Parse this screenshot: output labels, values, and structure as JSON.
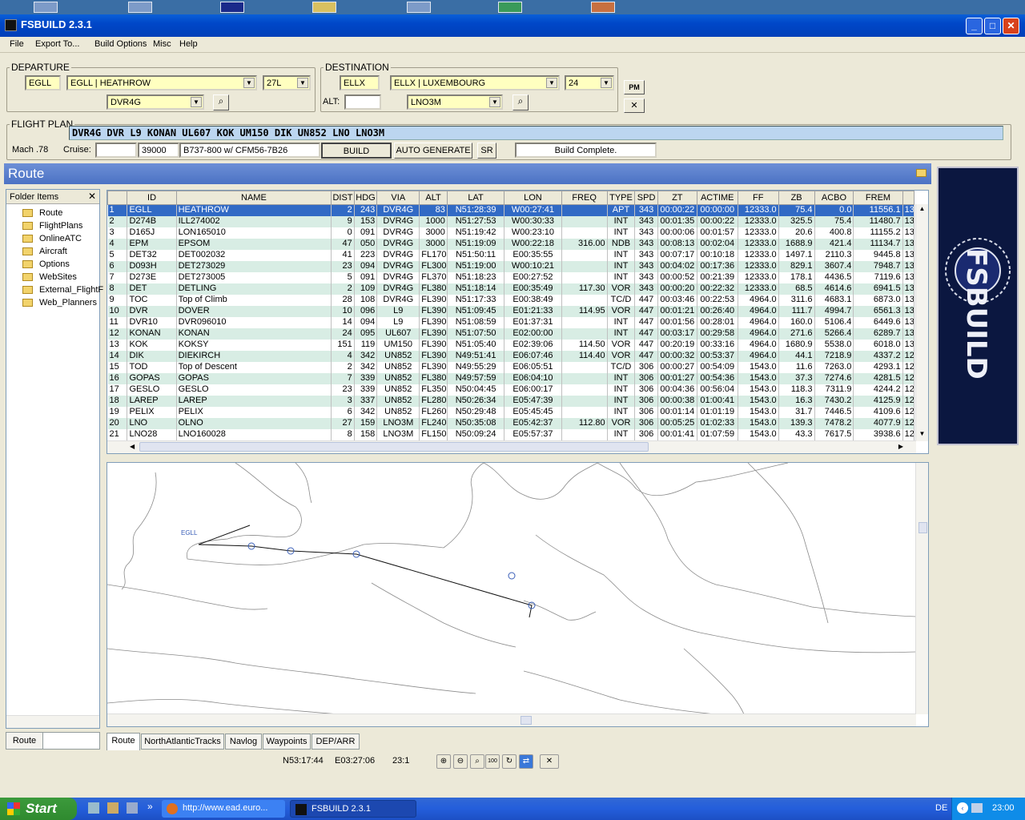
{
  "window": {
    "title": "FSBUILD 2.3.1"
  },
  "menu": [
    "File",
    "Export To...",
    "Build Options",
    "Misc",
    "Help"
  ],
  "departure": {
    "legend": "DEPARTURE",
    "icao": "EGLL",
    "airport": "EGLL | HEATHROW",
    "runway": "27L",
    "sid": "DVR4G"
  },
  "destination": {
    "legend": "DESTINATION",
    "icao": "ELLX",
    "airport": "ELLX | LUXEMBOURG",
    "runway": "24",
    "alt_label": "ALT:",
    "alt_value": "",
    "star": "LNO3M"
  },
  "buttons": {
    "pm": "PM",
    "close": "✕",
    "build": "BUILD",
    "auto": "AUTO GENERATE",
    "sr": "SR"
  },
  "flightplan": {
    "legend": "FLIGHT PLAN",
    "route": "DVR4G DVR L9 KONAN UL607 KOK UM150 DIK UN852 LNO  LNO3M",
    "mach": "Mach .78",
    "cruise_label": "Cruise:",
    "cruise_blank": "",
    "cruise_alt": "39000",
    "aircraft": "B737-800 w/ CFM56-7B26",
    "status": "Build Complete."
  },
  "section_title": "Route",
  "folders": {
    "header": "Folder Items",
    "items": [
      "Route",
      "FlightPlans",
      "OnlineATC",
      "Aircraft",
      "Options",
      "WebSites",
      "External_FlightF",
      "Web_Planners"
    ],
    "bottom_tab": "Route"
  },
  "grid": {
    "columns": [
      "",
      "ID",
      "NAME",
      "DIST",
      "HDG",
      "VIA",
      "ALT",
      "LAT",
      "LON",
      "FREQ",
      "TYPE",
      "SPD",
      "ZT",
      "ACTIME",
      "FF",
      "ZB",
      "ACBO",
      "FREM",
      ""
    ],
    "rows": [
      [
        "1",
        "EGLL",
        "HEATHROW",
        "2",
        "243",
        "DVR4G",
        "83",
        "N51:28:39",
        "W00:27:41",
        "",
        "APT",
        "343",
        "00:00:22",
        "00:00:00",
        "12333.0",
        "75.4",
        "0.0",
        "11556.1",
        "13"
      ],
      [
        "2",
        "D274B",
        "ILL274002",
        "9",
        "153",
        "DVR4G",
        "1000",
        "N51:27:53",
        "W00:30:33",
        "",
        "INT",
        "343",
        "00:01:35",
        "00:00:22",
        "12333.0",
        "325.5",
        "75.4",
        "11480.7",
        "13"
      ],
      [
        "3",
        "D165J",
        "LON165010",
        "0",
        "091",
        "DVR4G",
        "3000",
        "N51:19:42",
        "W00:23:10",
        "",
        "INT",
        "343",
        "00:00:06",
        "00:01:57",
        "12333.0",
        "20.6",
        "400.8",
        "11155.2",
        "13"
      ],
      [
        "4",
        "EPM",
        "EPSOM",
        "47",
        "050",
        "DVR4G",
        "3000",
        "N51:19:09",
        "W00:22:18",
        "316.00",
        "NDB",
        "343",
        "00:08:13",
        "00:02:04",
        "12333.0",
        "1688.9",
        "421.4",
        "11134.7",
        "13"
      ],
      [
        "5",
        "DET32",
        "DET002032",
        "41",
        "223",
        "DVR4G",
        "FL170",
        "N51:50:11",
        "E00:35:55",
        "",
        "INT",
        "343",
        "00:07:17",
        "00:10:18",
        "12333.0",
        "1497.1",
        "2110.3",
        "9445.8",
        "13"
      ],
      [
        "6",
        "D093H",
        "DET273029",
        "23",
        "094",
        "DVR4G",
        "FL300",
        "N51:19:00",
        "W00:10:21",
        "",
        "INT",
        "343",
        "00:04:02",
        "00:17:36",
        "12333.0",
        "829.1",
        "3607.4",
        "7948.7",
        "13"
      ],
      [
        "7",
        "D273E",
        "DET273005",
        "5",
        "091",
        "DVR4G",
        "FL370",
        "N51:18:23",
        "E00:27:52",
        "",
        "INT",
        "343",
        "00:00:52",
        "00:21:39",
        "12333.0",
        "178.1",
        "4436.5",
        "7119.6",
        "13"
      ],
      [
        "8",
        "DET",
        "DETLING",
        "2",
        "109",
        "DVR4G",
        "FL380",
        "N51:18:14",
        "E00:35:49",
        "117.30",
        "VOR",
        "343",
        "00:00:20",
        "00:22:32",
        "12333.0",
        "68.5",
        "4614.6",
        "6941.5",
        "13"
      ],
      [
        "9",
        "TOC",
        "Top of Climb",
        "28",
        "108",
        "DVR4G",
        "FL390",
        "N51:17:33",
        "E00:38:49",
        "",
        "TC/D",
        "447",
        "00:03:46",
        "00:22:53",
        "4964.0",
        "311.6",
        "4683.1",
        "6873.0",
        "13"
      ],
      [
        "10",
        "DVR",
        "DOVER",
        "10",
        "096",
        "L9",
        "FL390",
        "N51:09:45",
        "E01:21:33",
        "114.95",
        "VOR",
        "447",
        "00:01:21",
        "00:26:40",
        "4964.0",
        "111.7",
        "4994.7",
        "6561.3",
        "13"
      ],
      [
        "11",
        "DVR10",
        "DVR096010",
        "14",
        "094",
        "L9",
        "FL390",
        "N51:08:59",
        "E01:37:31",
        "",
        "INT",
        "447",
        "00:01:56",
        "00:28:01",
        "4964.0",
        "160.0",
        "5106.4",
        "6449.6",
        "13"
      ],
      [
        "12",
        "KONAN",
        "KONAN",
        "24",
        "095",
        "UL607",
        "FL390",
        "N51:07:50",
        "E02:00:00",
        "",
        "INT",
        "447",
        "00:03:17",
        "00:29:58",
        "4964.0",
        "271.6",
        "5266.4",
        "6289.7",
        "13"
      ],
      [
        "13",
        "KOK",
        "KOKSY",
        "151",
        "119",
        "UM150",
        "FL390",
        "N51:05:40",
        "E02:39:06",
        "114.50",
        "VOR",
        "447",
        "00:20:19",
        "00:33:16",
        "4964.0",
        "1680.9",
        "5538.0",
        "6018.0",
        "13"
      ],
      [
        "14",
        "DIK",
        "DIEKIRCH",
        "4",
        "342",
        "UN852",
        "FL390",
        "N49:51:41",
        "E06:07:46",
        "114.40",
        "VOR",
        "447",
        "00:00:32",
        "00:53:37",
        "4964.0",
        "44.1",
        "7218.9",
        "4337.2",
        "12"
      ],
      [
        "15",
        "TOD",
        "Top of Descent",
        "2",
        "342",
        "UN852",
        "FL390",
        "N49:55:29",
        "E06:05:51",
        "",
        "TC/D",
        "306",
        "00:00:27",
        "00:54:09",
        "1543.0",
        "11.6",
        "7263.0",
        "4293.1",
        "12"
      ],
      [
        "16",
        "GOPAS",
        "GOPAS",
        "7",
        "339",
        "UN852",
        "FL380",
        "N49:57:59",
        "E06:04:10",
        "",
        "INT",
        "306",
        "00:01:27",
        "00:54:36",
        "1543.0",
        "37.3",
        "7274.6",
        "4281.5",
        "12"
      ],
      [
        "17",
        "GESLO",
        "GESLO",
        "23",
        "339",
        "UN852",
        "FL350",
        "N50:04:45",
        "E06:00:17",
        "",
        "INT",
        "306",
        "00:04:36",
        "00:56:04",
        "1543.0",
        "118.3",
        "7311.9",
        "4244.2",
        "12"
      ],
      [
        "18",
        "LAREP",
        "LAREP",
        "3",
        "337",
        "UN852",
        "FL280",
        "N50:26:34",
        "E05:47:39",
        "",
        "INT",
        "306",
        "00:00:38",
        "01:00:41",
        "1543.0",
        "16.3",
        "7430.2",
        "4125.9",
        "12"
      ],
      [
        "19",
        "PELIX",
        "PELIX",
        "6",
        "342",
        "UN852",
        "FL260",
        "N50:29:48",
        "E05:45:45",
        "",
        "INT",
        "306",
        "00:01:14",
        "01:01:19",
        "1543.0",
        "31.7",
        "7446.5",
        "4109.6",
        "12"
      ],
      [
        "20",
        "LNO",
        "OLNO",
        "27",
        "159",
        "LNO3M",
        "FL240",
        "N50:35:08",
        "E05:42:37",
        "112.80",
        "VOR",
        "306",
        "00:05:25",
        "01:02:33",
        "1543.0",
        "139.3",
        "7478.2",
        "4077.9",
        "12"
      ],
      [
        "21",
        "LNO28",
        "LNO160028",
        "8",
        "158",
        "LNO3M",
        "FL150",
        "N50:09:24",
        "E05:57:37",
        "",
        "INT",
        "306",
        "00:01:41",
        "01:07:59",
        "1543.0",
        "43.3",
        "7617.5",
        "3938.6",
        "12"
      ]
    ]
  },
  "map": {
    "label_egll": "EGLL"
  },
  "tabs": [
    "Route",
    "NorthAtlanticTracks",
    "Navlog",
    "Waypoints",
    "DEP/ARR"
  ],
  "statusbar": {
    "lat": "N53:17:44",
    "lon": "E03:27:06",
    "scale": "23:1"
  },
  "logo": {
    "text": "FSBUILD"
  },
  "taskbar": {
    "start": "Start",
    "tasks": [
      "http://www.ead.euro...",
      "FSBUILD 2.3.1"
    ],
    "lang": "DE",
    "clock": "23:00",
    "quicklaunch": "»"
  }
}
